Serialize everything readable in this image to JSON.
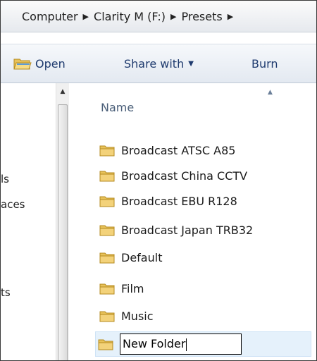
{
  "address": {
    "crumbs": [
      "Computer",
      "Clarity M (F:)",
      "Presets"
    ],
    "separator": "▶"
  },
  "toolbar": {
    "open_label": "Open",
    "share_label": "Share with",
    "share_caret": "▼",
    "burn_label": "Burn"
  },
  "nav": {
    "items": [
      "ls",
      "aces",
      "ts"
    ]
  },
  "scrollbar": {
    "up_glyph": "▲"
  },
  "list": {
    "header": "Name",
    "sort_glyph": "▲",
    "folders": [
      "Broadcast ATSC A85",
      "Broadcast China CCTV",
      "Broadcast EBU R128",
      "Broadcast Japan TRB32",
      "Default",
      "Film",
      "Music"
    ],
    "rename_value": "New Folder"
  },
  "colors": {
    "folder": "#e8c25a",
    "selection": "#e5f1fb",
    "toolbar_text": "#1e3a6e"
  }
}
